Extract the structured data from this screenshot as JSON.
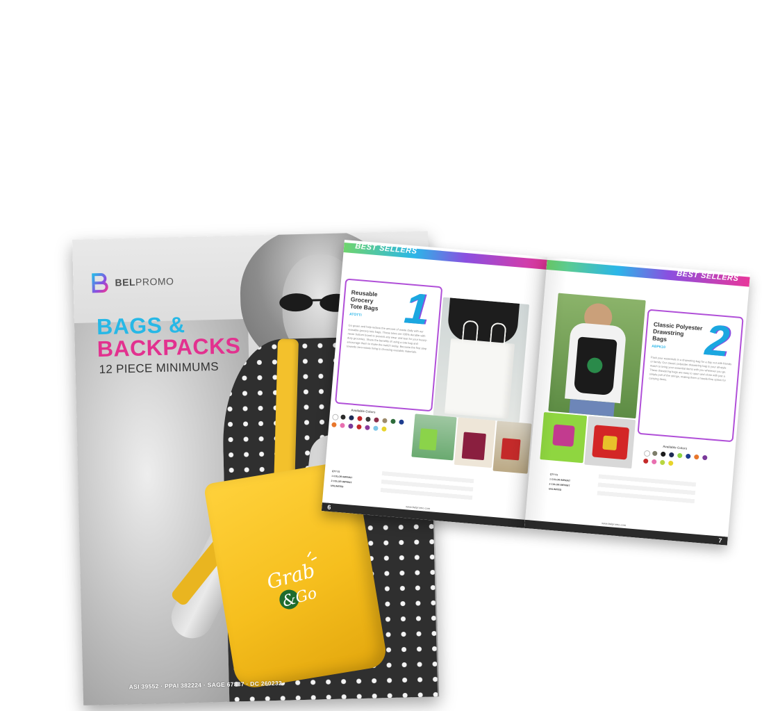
{
  "cover": {
    "brand": "BELPROMO",
    "brand_bold": "BEL",
    "brand_rest": "PROMO",
    "title_line1": "BAGS &",
    "title_line2": "BACKPACKS",
    "subtitle": "12 PIECE MINIMUMS",
    "ids": "ASI 39552 · PPAI 382224 · SAGE 67337 · DC 260232",
    "bag_logo_line1": "Grab",
    "bag_logo_line2": "&Go"
  },
  "spread": {
    "band_label_left": "BEST SELLERS",
    "band_label_right": "BEST SELLERS",
    "website": "www.belpromo.com",
    "left": {
      "number": "1",
      "title_l1": "Reusable",
      "title_l2": "Grocery",
      "title_l3": "Tote Bags",
      "code": "ATOTTI",
      "body": "Go green and help reduce the amount of waste daily with our reusable grocery tote bags. These totes are 100% durable with never bottom board to prevent any wear and tear for your heavy-duty groceries. Share the benefits of using a tote bag and encourage them to make the switch today. Because the first step towards zero-waste living is choosing reusable materials.",
      "colors_label": "Available Colors",
      "page_number": "6"
    },
    "right": {
      "number": "2",
      "title_l1": "Classic Polyester",
      "title_l2": "Drawstring",
      "title_l3": "Bags",
      "code": "ABPK10",
      "body": "Pack your essentials in a drawstring bag for a day out with friends or family. Our classic polyester drawstring bag is your all-style match to bring your essential items with you wherever you go. These drawstring bags are easy to open and close with just a simple pull of the strings, making them a hassle-free option for carrying items.",
      "colors_label": "Available Colors",
      "page_number": "7"
    },
    "price_labels": [
      "QTY 01",
      "1 COLOR IMPRINT",
      "2 COLOR IMPRINT",
      "UNLIMITED"
    ]
  },
  "colors": {
    "brand_blue": "#27b8e6",
    "brand_pink": "#e2318f",
    "card_border": "#b04fd8",
    "bag_yellow": "#f6bf1e"
  }
}
